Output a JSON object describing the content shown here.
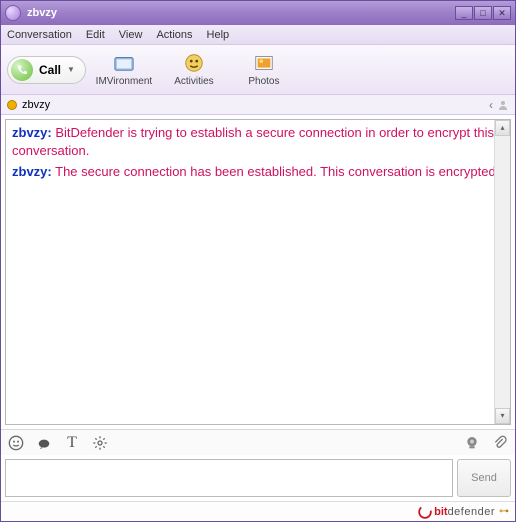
{
  "window": {
    "title": "zbvzy"
  },
  "menu": {
    "conversation": "Conversation",
    "edit": "Edit",
    "view": "View",
    "actions": "Actions",
    "help": "Help"
  },
  "toolbar": {
    "call_label": "Call",
    "imvironment": "IMVironment",
    "activities": "Activities",
    "photos": "Photos"
  },
  "contact": {
    "name": "zbvzy"
  },
  "messages": [
    {
      "sender": "zbvzy:",
      "body": "BitDefender is trying to establish a secure connection in order to encrypt this conversation."
    },
    {
      "sender": "zbvzy:",
      "body": "The secure connection has been established. This conversation is encrypted."
    }
  ],
  "compose": {
    "send_label": "Send",
    "placeholder": ""
  },
  "brand": {
    "prefix": "bit",
    "suffix": "defender"
  }
}
